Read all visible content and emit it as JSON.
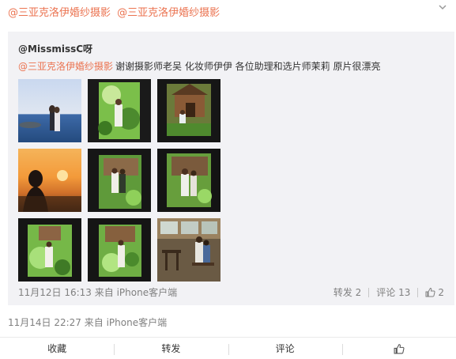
{
  "header": {
    "repost_links": [
      "@三亚克洛伊婚纱摄影",
      "@三亚克洛伊婚纱摄影"
    ],
    "menu_icon": "chevron-down-icon"
  },
  "quote": {
    "author": "@MissmissC呀",
    "mention": "@三亚克洛伊婚纱摄影",
    "text": "谢谢摄影师老吴 化妆师伊伊 各位助理和选片师茉莉 原片很漂亮",
    "photos": [
      "photo-beach-couple",
      "photo-green-screen-1",
      "photo-wooden-house",
      "photo-sunset-silhouette",
      "photo-green-screen-2",
      "photo-green-screen-3",
      "photo-green-screen-4",
      "photo-green-screen-5",
      "photo-cafe-couple"
    ],
    "time": "11月12日 16:13 来自 iPhone客户端",
    "actions": {
      "repost": "转发 2",
      "comment": "评论 13",
      "like": "2"
    }
  },
  "post": {
    "time": "11月14日 22:27 来自 iPhone客户端"
  },
  "bottom_bar": {
    "favorite": "收藏",
    "repost": "转发",
    "comment": "评论",
    "like_icon": "thumbs-up-icon"
  },
  "colors": {
    "accent": "#eb7350",
    "quote_bg": "#f2f2f5",
    "muted_text": "#808080"
  }
}
